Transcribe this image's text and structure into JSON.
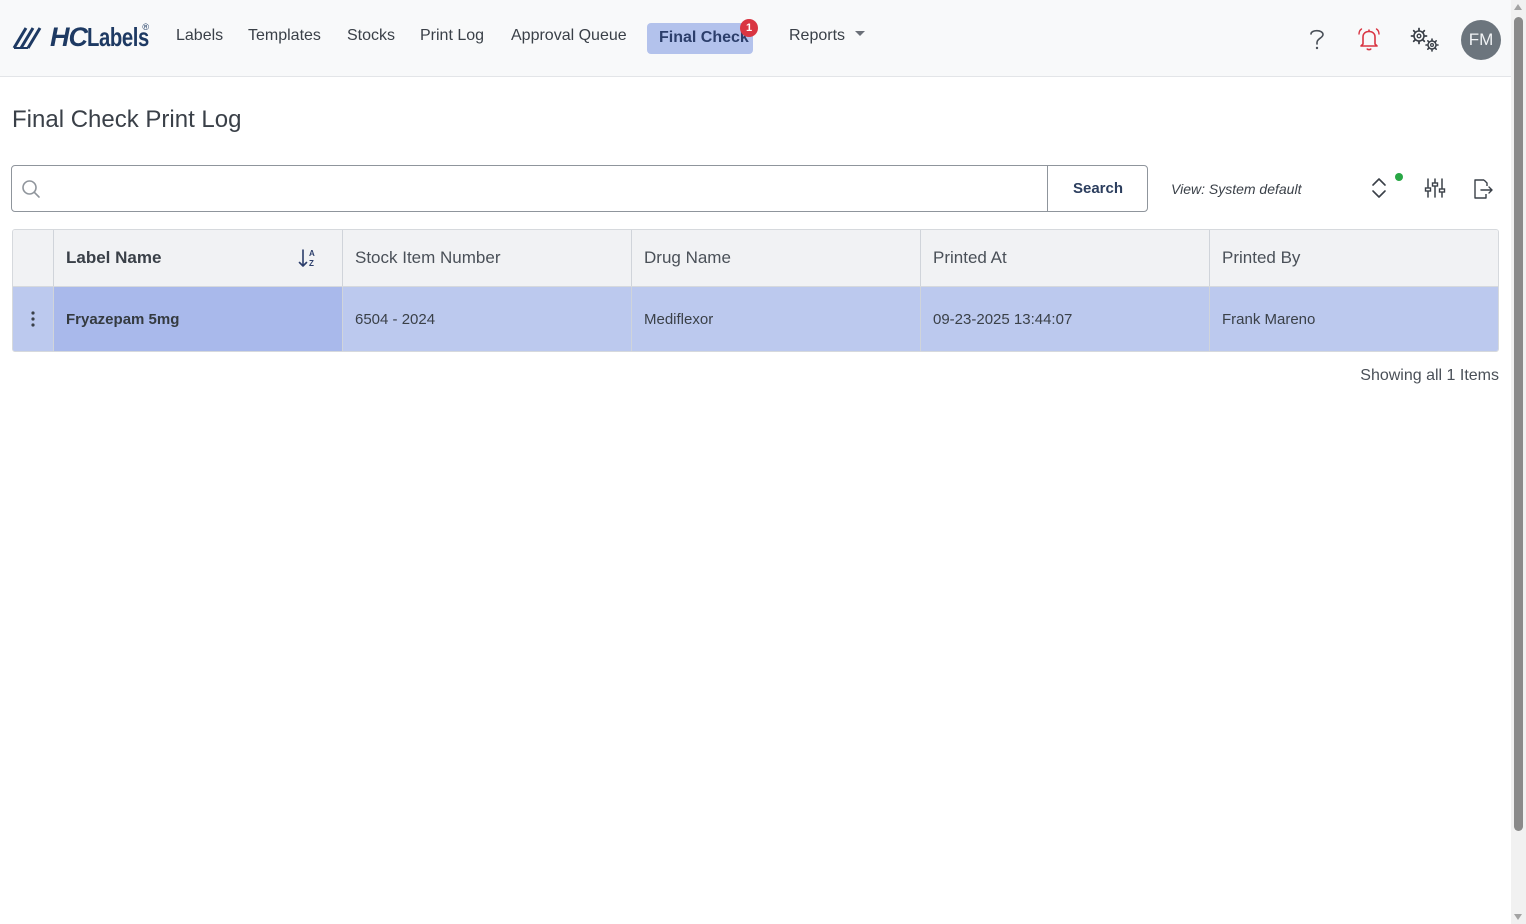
{
  "app": {
    "logo_text_prefix": "HC",
    "logo_text_suffix": "Labels",
    "logo_reg": "®"
  },
  "nav": {
    "items": [
      {
        "label": "Labels"
      },
      {
        "label": "Templates"
      },
      {
        "label": "Stocks"
      },
      {
        "label": "Print Log"
      },
      {
        "label": "Approval Queue"
      },
      {
        "label": "Final Check",
        "badge": "1",
        "active": true
      },
      {
        "label": "Reports"
      }
    ],
    "icons": [
      "help-icon",
      "bell-icon",
      "settings-icon"
    ],
    "avatar_initials": "FM",
    "bell_color": "#d93542",
    "active_bg": "#b3c2ec"
  },
  "page": {
    "title": "Final Check Print Log"
  },
  "search": {
    "placeholder": "",
    "value": "",
    "button_label": "Search"
  },
  "view": {
    "label": "View: System default",
    "icons": [
      "expand-collapse-icon",
      "filter-sliders-icon",
      "export-icon"
    ],
    "status_dot_color": "#28a745"
  },
  "table": {
    "columns": [
      "Label Name",
      "Stock Item Number",
      "Drug Name",
      "Printed At",
      "Printed By"
    ],
    "rows": [
      {
        "label_name": "Fryazepam 5mg",
        "stock_item_number": "6504 - 2024",
        "drug_name": "Mediflexor",
        "printed_at": "09-23-2025 13:44:07",
        "printed_by": "Frank Mareno"
      }
    ],
    "footer": "Showing all 1 Items",
    "selected_row_color": "#bcc9ee"
  }
}
